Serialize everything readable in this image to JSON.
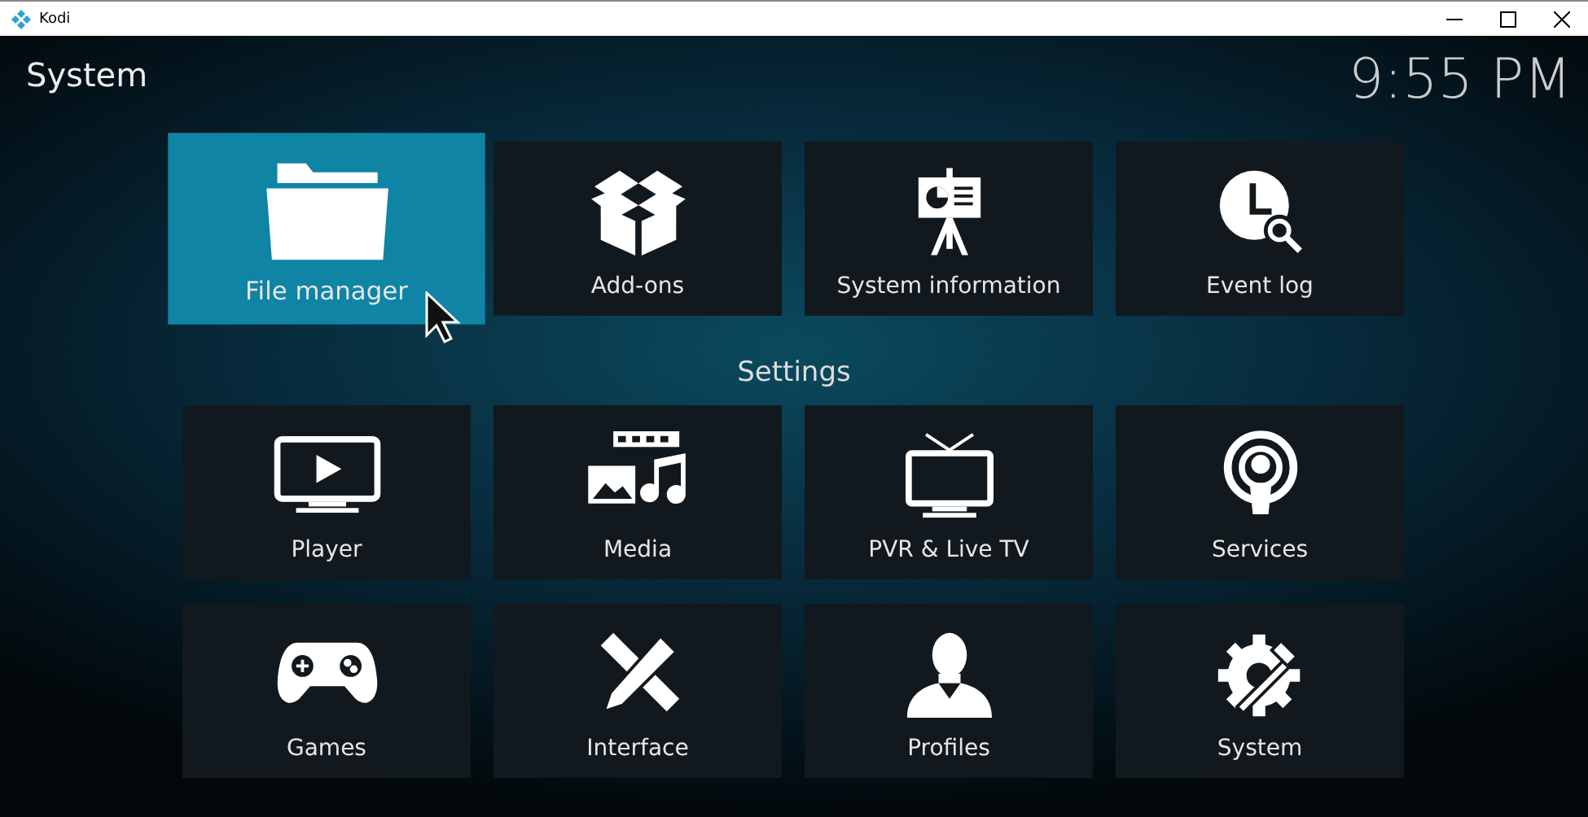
{
  "window": {
    "title": "Kodi"
  },
  "header": {
    "title": "System",
    "clock": "9:55 PM"
  },
  "top_tiles": [
    {
      "label": "File manager",
      "kind": "folder",
      "selected": true
    },
    {
      "label": "Add-ons",
      "kind": "box",
      "selected": false
    },
    {
      "label": "System information",
      "kind": "easel",
      "selected": false
    },
    {
      "label": "Event log",
      "kind": "clock",
      "selected": false
    }
  ],
  "settings": {
    "heading": "Settings",
    "tiles": [
      {
        "label": "Player",
        "kind": "monitor",
        "selected": false
      },
      {
        "label": "Media",
        "kind": "media",
        "selected": false
      },
      {
        "label": "PVR & Live TV",
        "kind": "tv",
        "selected": false
      },
      {
        "label": "Services",
        "kind": "broadcast",
        "selected": false
      },
      {
        "label": "Games",
        "kind": "gamepad",
        "selected": false
      },
      {
        "label": "Interface",
        "kind": "tools",
        "selected": false
      },
      {
        "label": "Profiles",
        "kind": "person",
        "selected": false
      },
      {
        "label": "System",
        "kind": "gear",
        "selected": false
      }
    ]
  }
}
